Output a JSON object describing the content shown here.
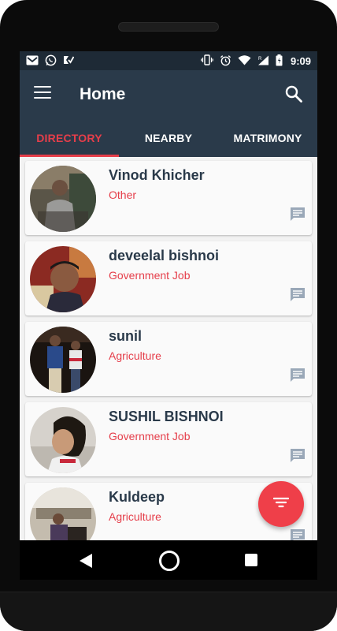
{
  "status_bar": {
    "time": "9:09",
    "left_icons": [
      "gmail-icon",
      "whatsapp-icon",
      "task-check-icon"
    ],
    "right_icons": [
      "vibrate-icon",
      "alarm-icon",
      "wifi-icon",
      "signal-icon",
      "battery-charging-icon"
    ]
  },
  "app_bar": {
    "title": "Home",
    "menu_icon": "hamburger-menu-icon",
    "search_icon": "search-icon",
    "background": "#2a3a4a"
  },
  "tabs": [
    {
      "label": "DIRECTORY",
      "active": true
    },
    {
      "label": "NEARBY",
      "active": false
    },
    {
      "label": "MATRIMONY",
      "active": false
    }
  ],
  "accent_color": "#e53e4a",
  "people": [
    {
      "name": "Vinod Khicher",
      "profession": "Other"
    },
    {
      "name": "deveelal bishnoi",
      "profession": "Government Job"
    },
    {
      "name": "sunil",
      "profession": "Agriculture"
    },
    {
      "name": "SUSHIL BISHNOI",
      "profession": "Government Job"
    },
    {
      "name": "Kuldeep",
      "profession": "Agriculture"
    }
  ],
  "fab": {
    "icon": "filter-icon"
  },
  "nav_bar": {
    "icons": [
      "back-icon",
      "home-icon",
      "recents-icon"
    ]
  }
}
